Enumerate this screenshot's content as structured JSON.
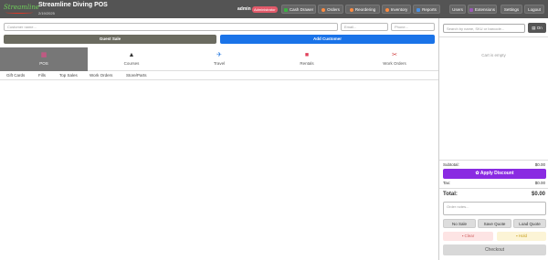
{
  "header": {
    "logo_text": "Streamline",
    "title": "Streamline Diving POS",
    "date": "2/19/2025",
    "user": "admin",
    "role": "Administrator",
    "nav": [
      {
        "label": "Cash Drawer",
        "icon": "cash-drawer-icon",
        "color": "#3cb043"
      },
      {
        "label": "Orders",
        "icon": "orders-icon",
        "color": "#ff8c42"
      },
      {
        "label": "Reordering",
        "icon": "reordering-icon",
        "color": "#ff8c42"
      },
      {
        "label": "Inventory",
        "icon": "inventory-icon",
        "color": "#ff8c42"
      },
      {
        "label": "Reports",
        "icon": "reports-icon",
        "color": "#4a90e2"
      },
      {
        "label": "Users",
        "icon": "",
        "color": ""
      },
      {
        "label": "Extensions",
        "icon": "extensions-icon",
        "color": "#9b59b6"
      },
      {
        "label": "Settings",
        "icon": "",
        "color": ""
      },
      {
        "label": "Logout",
        "icon": "",
        "color": ""
      }
    ]
  },
  "customer": {
    "name_placeholder": "Customer name...",
    "email_placeholder": "Email...",
    "phone_placeholder": "Phone...",
    "guest_label": "Guest Sale",
    "add_label": "Add Customer"
  },
  "categories": [
    {
      "label": "POS",
      "icon": "pos-icon",
      "active": true
    },
    {
      "label": "Courses",
      "icon": "courses-icon",
      "active": false
    },
    {
      "label": "Travel",
      "icon": "travel-icon",
      "active": false
    },
    {
      "label": "Rentals",
      "icon": "rentals-icon",
      "active": false
    },
    {
      "label": "Work Orders",
      "icon": "work-orders-icon",
      "active": false
    }
  ],
  "subtabs": [
    "Gift Cards",
    "Fills",
    "Top Sales",
    "Work Orders",
    "Store/Parts"
  ],
  "cart": {
    "search_placeholder": "Search by name, SKU or barcode...",
    "scan_label": "On",
    "empty_text": "Cart is empty",
    "subtotal_label": "Subtotal:",
    "subtotal_value": "$0.00",
    "discount_label": "Apply Discount",
    "tax_label": "Tax:",
    "tax_value": "$0.00",
    "total_label": "Total:",
    "total_value": "$0.00",
    "notes_placeholder": "Order notes...",
    "no_sale": "No Sale",
    "save_quote": "Save Quote",
    "load_quote": "Load Quote",
    "clear": "Clear",
    "hold": "Hold",
    "checkout": "Checkout"
  },
  "colors": {
    "header_bg": "#545454",
    "primary_blue": "#1a73e8",
    "discount_purple": "#8a2be2",
    "active_tab": "#777777"
  }
}
